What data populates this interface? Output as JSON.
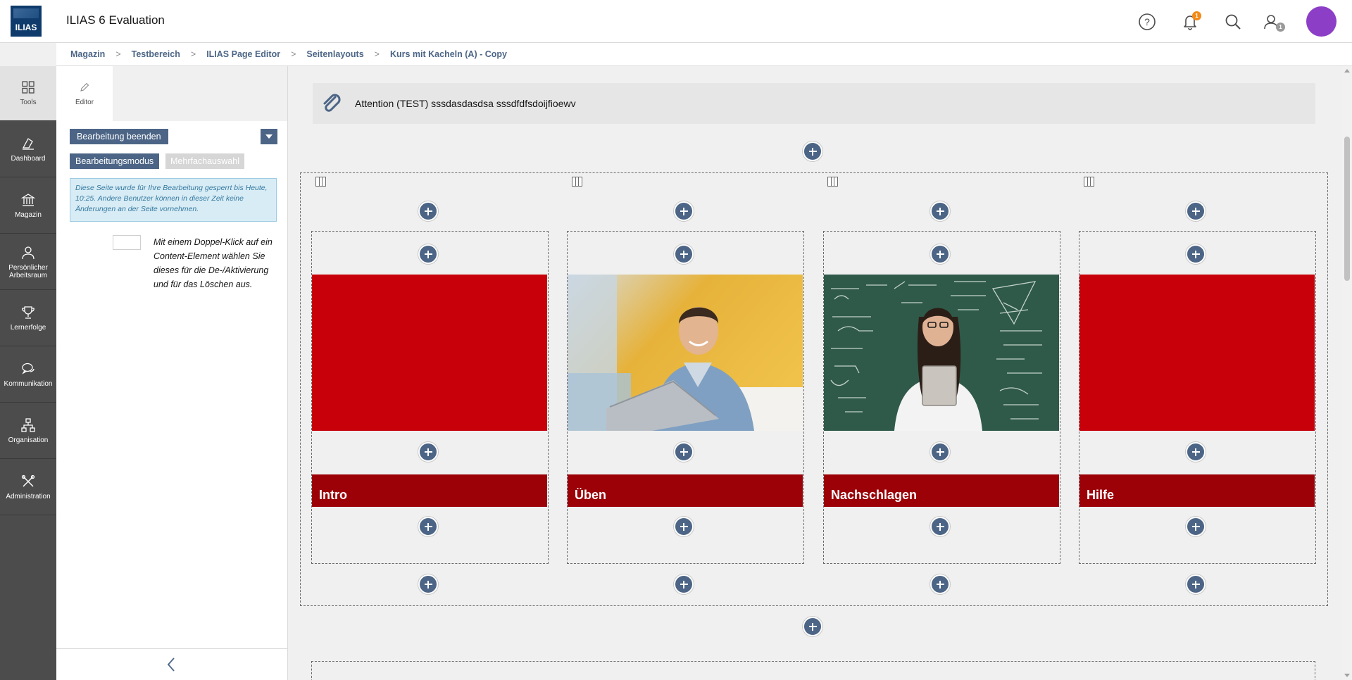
{
  "header": {
    "logo_text": "ILIAS",
    "app_title": "ILIAS 6 Evaluation",
    "notification_count": "1",
    "contacts_count": "1",
    "icons": [
      "help-icon",
      "bell-icon",
      "search-icon",
      "contacts-icon"
    ]
  },
  "breadcrumbs": [
    "Magazin",
    "Testbereich",
    "ILIAS Page Editor",
    "Seitenlayouts",
    "Kurs mit Kacheln (A) - Copy"
  ],
  "mainbar": {
    "items": [
      {
        "label": "Tools",
        "icon": "tools-grid-icon",
        "active": true
      },
      {
        "label": "Dashboard",
        "icon": "dashboard-icon"
      },
      {
        "label": "Magazin",
        "icon": "building-icon"
      },
      {
        "label": "Persönlicher Arbeitsraum",
        "icon": "person-icon"
      },
      {
        "label": "Lernerfolge",
        "icon": "trophy-icon"
      },
      {
        "label": "Kommunikation",
        "icon": "chat-icon"
      },
      {
        "label": "Organisation",
        "icon": "org-chart-icon"
      },
      {
        "label": "Administration",
        "icon": "wrench-icon"
      }
    ]
  },
  "slate": {
    "tab_label": "Editor",
    "finish_button": "Bearbeitung beenden",
    "mode_active": "Bearbeitungsmodus",
    "mode_inactive": "Mehrfachauswahl",
    "lock_info": "Diese Seite wurde für Ihre Bearbeitung gesperrt bis Heute, 10:25. Andere Benutzer können in dieser Zeit keine Änderungen an der Seite vornehmen.",
    "dblclick_hint": "Mit einem Doppel-Klick auf ein Content-Element wählen Sie dieses für die De-/Aktivierung und für das Löschen aus."
  },
  "content": {
    "attention_text": "Attention (TEST) sssdasdasdsa sssdfdfsdoijfioewv",
    "tiles": [
      {
        "label": "Intro",
        "image": "solid-red"
      },
      {
        "label": "Üben",
        "image": "student-laptop-photo"
      },
      {
        "label": "Nachschlagen",
        "image": "student-chalkboard-photo"
      },
      {
        "label": "Hilfe",
        "image": "solid-red"
      }
    ]
  },
  "colors": {
    "primary": "#4c6586",
    "tile_red": "#c8000a",
    "label_red": "#9b0107",
    "avatar": "#8c3fc6",
    "badge": "#f28a18"
  }
}
